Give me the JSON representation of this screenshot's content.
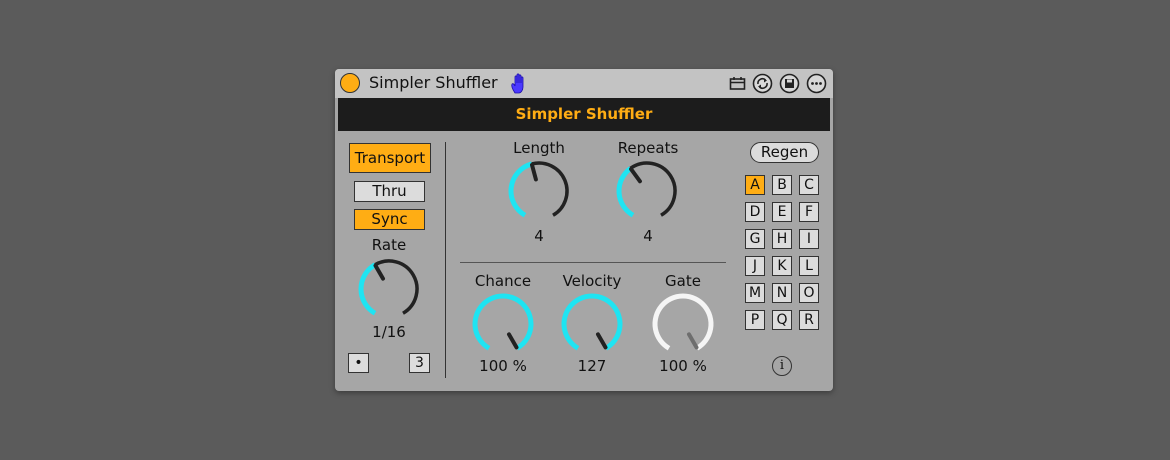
{
  "titlebar": {
    "title": "Simpler Shuffler",
    "icons": [
      "power-icon",
      "hand-icon",
      "tempo-icon",
      "hot-swap-icon",
      "save-icon",
      "more-icon"
    ]
  },
  "header": {
    "title": "Simpler Shuffler"
  },
  "left": {
    "transport_label": "Transport",
    "thru_label": "Thru",
    "sync_label": "Sync",
    "rate_label": "Rate",
    "rate_value": "1/16",
    "triplet_label": "3",
    "dot_label": "•"
  },
  "knobs": {
    "length": {
      "label": "Length",
      "value": "4",
      "level": 0.45
    },
    "repeats": {
      "label": "Repeats",
      "value": "4",
      "level": 0.38
    },
    "rate": {
      "level": 0.4
    },
    "chance": {
      "label": "Chance",
      "value": "100 %",
      "level": 1.0
    },
    "velocity": {
      "label": "Velocity",
      "value": "127",
      "level": 1.0
    },
    "gate": {
      "label": "Gate",
      "value": "100 %",
      "level": 1.0
    }
  },
  "right": {
    "regen_label": "Regen",
    "slots": [
      "A",
      "B",
      "C",
      "D",
      "E",
      "F",
      "G",
      "H",
      "I",
      "J",
      "K",
      "L",
      "M",
      "N",
      "O",
      "P",
      "Q",
      "R"
    ],
    "selected_slot": "A",
    "info_label": "i"
  },
  "colors": {
    "accent": "#ffad14",
    "knob_arc": "#1fe4f2",
    "gate_arc": "#f5f5f5",
    "panel": "#a6a6a6"
  }
}
